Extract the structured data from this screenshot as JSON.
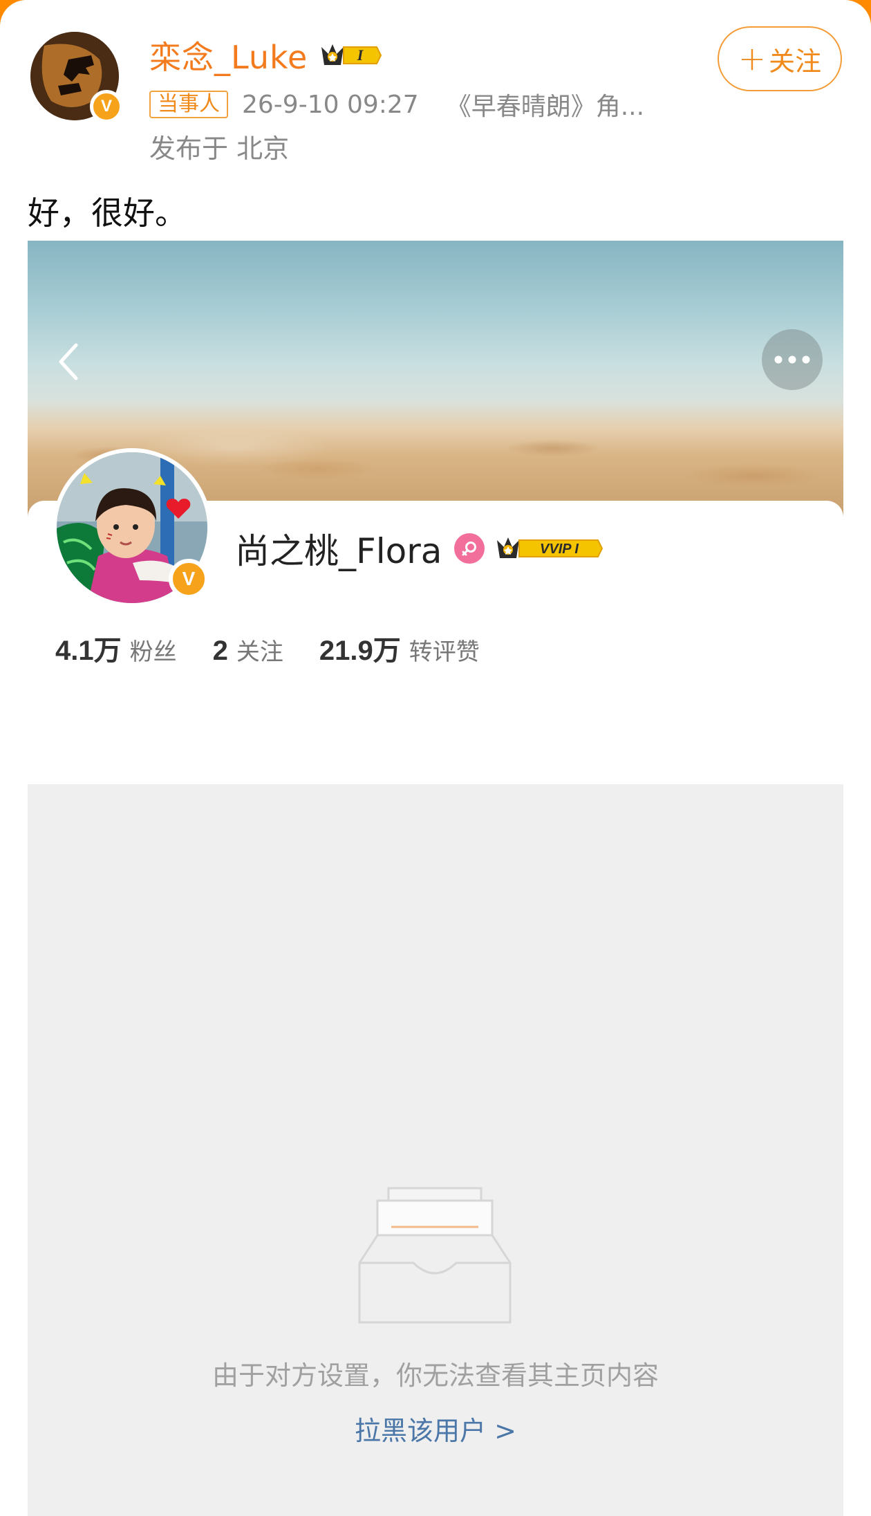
{
  "post": {
    "author_name": "栾念_Luke",
    "author_rank_badge": "I",
    "party_tag": "当事人",
    "time": "26-9-10 09:27",
    "source": "《早春晴朗》角...",
    "location": "发布于 北京",
    "follow_label": "关注",
    "follow_plus": "+",
    "text": "好，很好。",
    "verified_mark": "V"
  },
  "profile": {
    "name": "尚之桃_Flora",
    "vip_badge": "VVIP I",
    "verified_mark": "V",
    "stats": [
      {
        "value": "4.1万",
        "label": "粉丝"
      },
      {
        "value": "2",
        "label": "关注"
      },
      {
        "value": "21.9万",
        "label": "转评赞"
      }
    ],
    "blocked_message": "由于对方设置，你无法查看其主页内容",
    "block_link": "拉黑该用户 >"
  },
  "icons": {
    "back": "chevron-left-icon",
    "more": "more-dots-icon",
    "gender": "female-icon",
    "crown": "crown-icon",
    "empty": "empty-inbox-icon"
  },
  "colors": {
    "accent_orange": "#f37b1d",
    "link_blue": "#4a76a8",
    "verified_gold": "#f7a21b",
    "female_pink": "#f26e9b"
  }
}
